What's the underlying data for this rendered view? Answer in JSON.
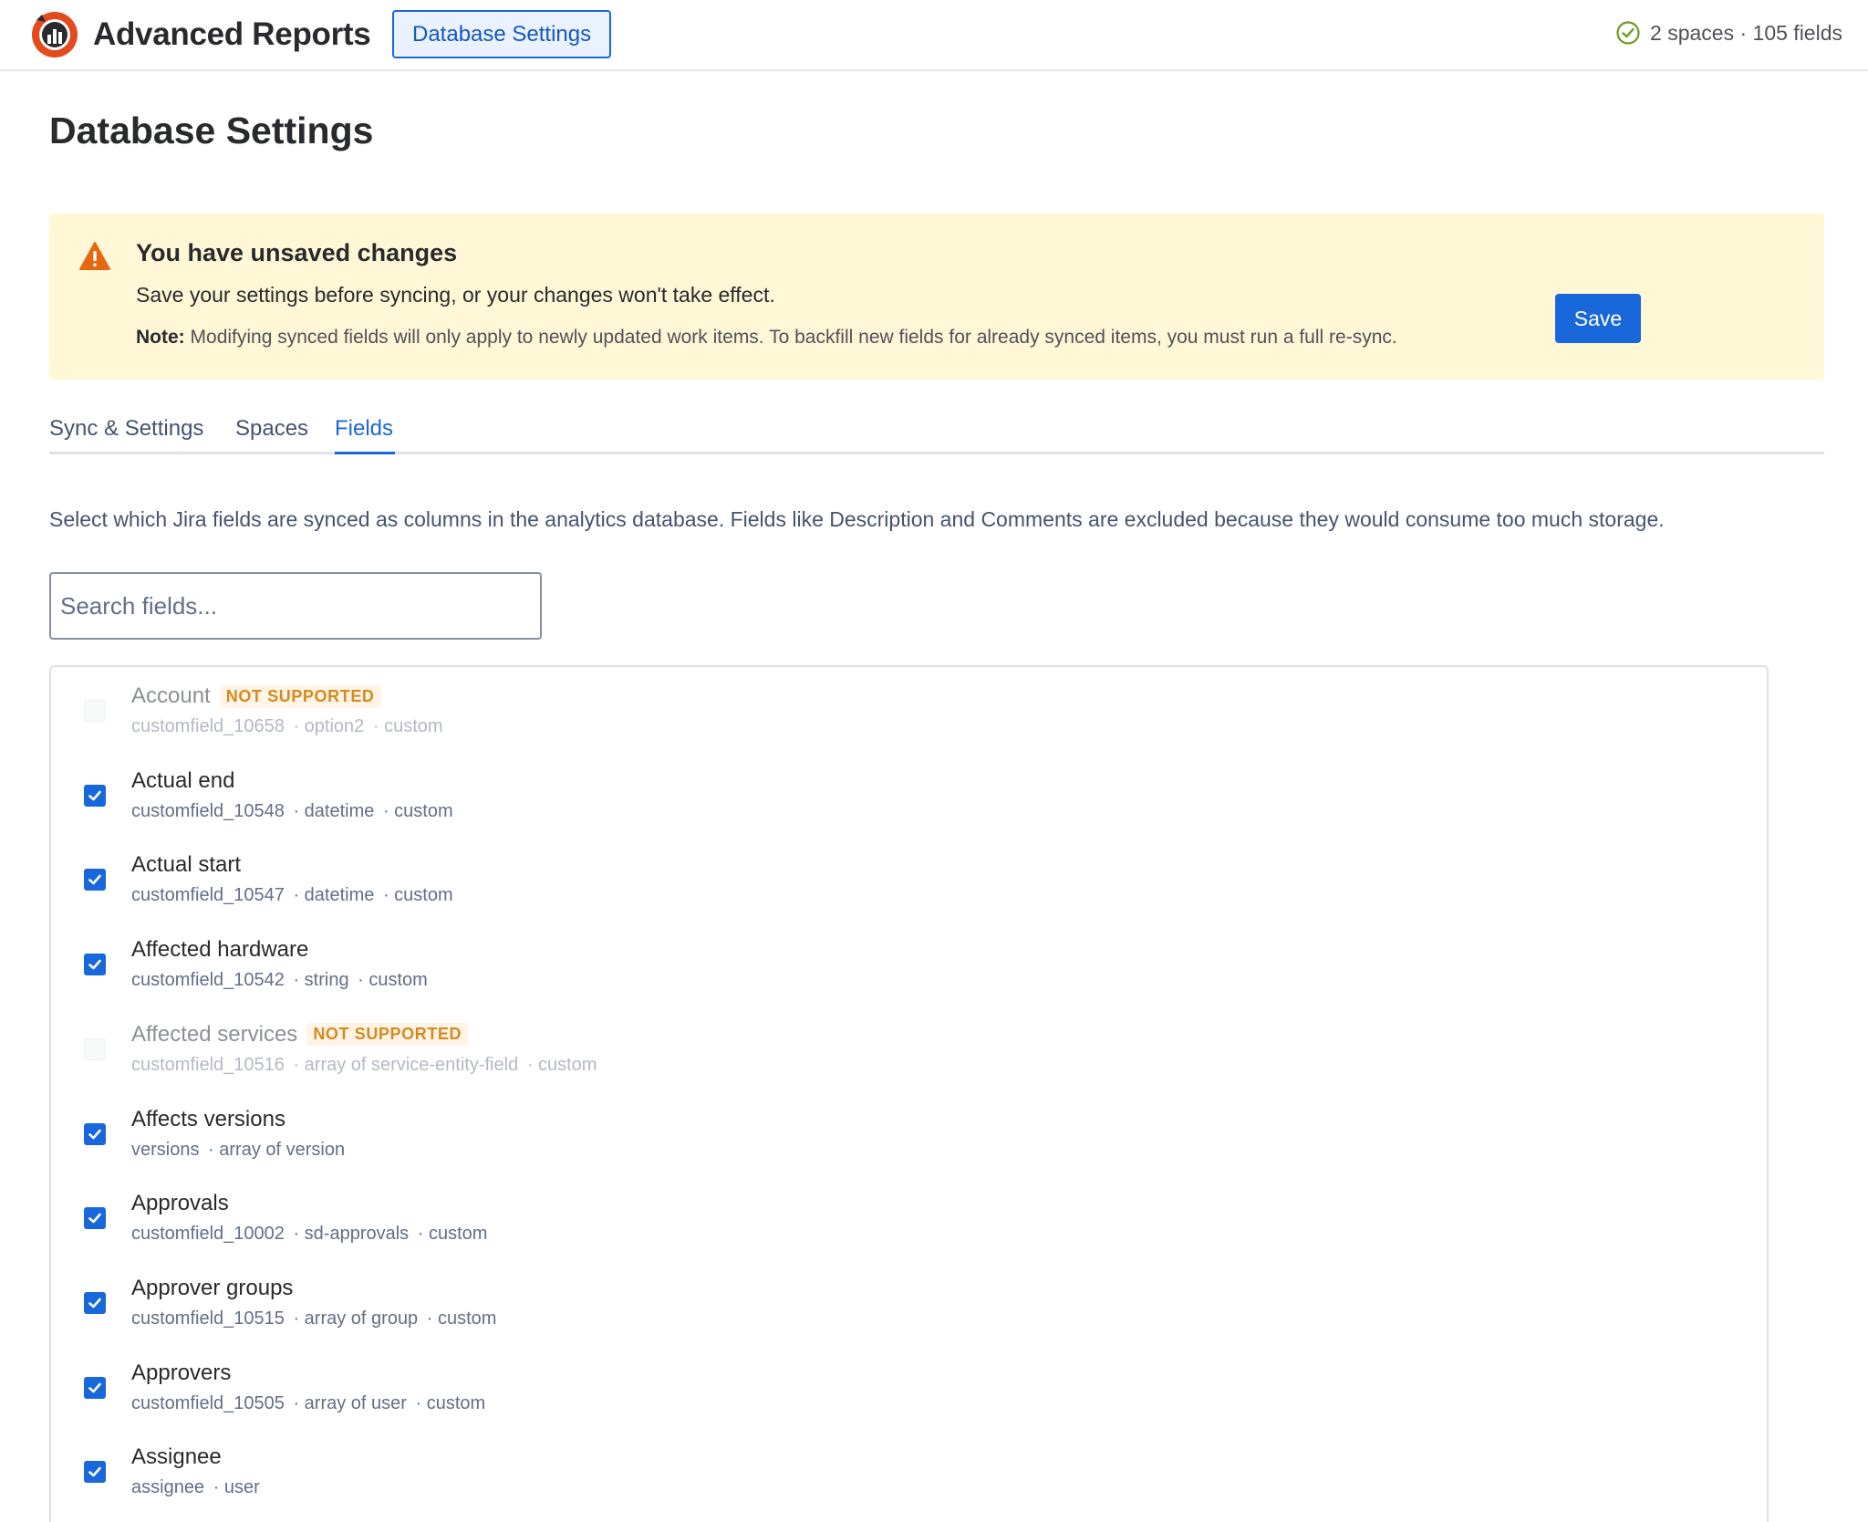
{
  "header": {
    "app_title": "Advanced Reports",
    "nav_button": "Database Settings",
    "status": "2 spaces · 105 fields",
    "brand_color": "#1868db",
    "logo_color": "#e34a1c"
  },
  "page": {
    "title": "Database Settings"
  },
  "banner": {
    "title": "You have unsaved changes",
    "body": "Save your settings before syncing, or your changes won't take effect.",
    "note_label": "Note:",
    "note_text": "Modifying synced fields will only apply to newly updated work items. To backfill new fields for already synced items, you must run a full re-sync.",
    "save_label": "Save",
    "background": "#fff7d6"
  },
  "tabs": [
    {
      "label": "Sync & Settings",
      "active": false
    },
    {
      "label": "Spaces",
      "active": false
    },
    {
      "label": "Fields",
      "active": true
    }
  ],
  "fields_tab": {
    "description": "Select which Jira fields are synced as columns in the analytics database. Fields like Description and Comments are excluded because they would consume too much storage.",
    "search_placeholder": "Search fields...",
    "badge_label": "NOT SUPPORTED",
    "items": [
      {
        "name": "Account",
        "id": "customfield_10658",
        "type": "option2",
        "source": "custom",
        "checked": false,
        "supported": false
      },
      {
        "name": "Actual end",
        "id": "customfield_10548",
        "type": "datetime",
        "source": "custom",
        "checked": true,
        "supported": true
      },
      {
        "name": "Actual start",
        "id": "customfield_10547",
        "type": "datetime",
        "source": "custom",
        "checked": true,
        "supported": true
      },
      {
        "name": "Affected hardware",
        "id": "customfield_10542",
        "type": "string",
        "source": "custom",
        "checked": true,
        "supported": true
      },
      {
        "name": "Affected services",
        "id": "customfield_10516",
        "type": "array of service-entity-field",
        "source": "custom",
        "checked": false,
        "supported": false
      },
      {
        "name": "Affects versions",
        "id": "versions",
        "type": "array of version",
        "source": "",
        "checked": true,
        "supported": true
      },
      {
        "name": "Approvals",
        "id": "customfield_10002",
        "type": "sd-approvals",
        "source": "custom",
        "checked": true,
        "supported": true
      },
      {
        "name": "Approver groups",
        "id": "customfield_10515",
        "type": "array of group",
        "source": "custom",
        "checked": true,
        "supported": true
      },
      {
        "name": "Approvers",
        "id": "customfield_10505",
        "type": "array of user",
        "source": "custom",
        "checked": true,
        "supported": true
      },
      {
        "name": "Assignee",
        "id": "assignee",
        "type": "user",
        "source": "",
        "checked": true,
        "supported": true
      }
    ]
  }
}
